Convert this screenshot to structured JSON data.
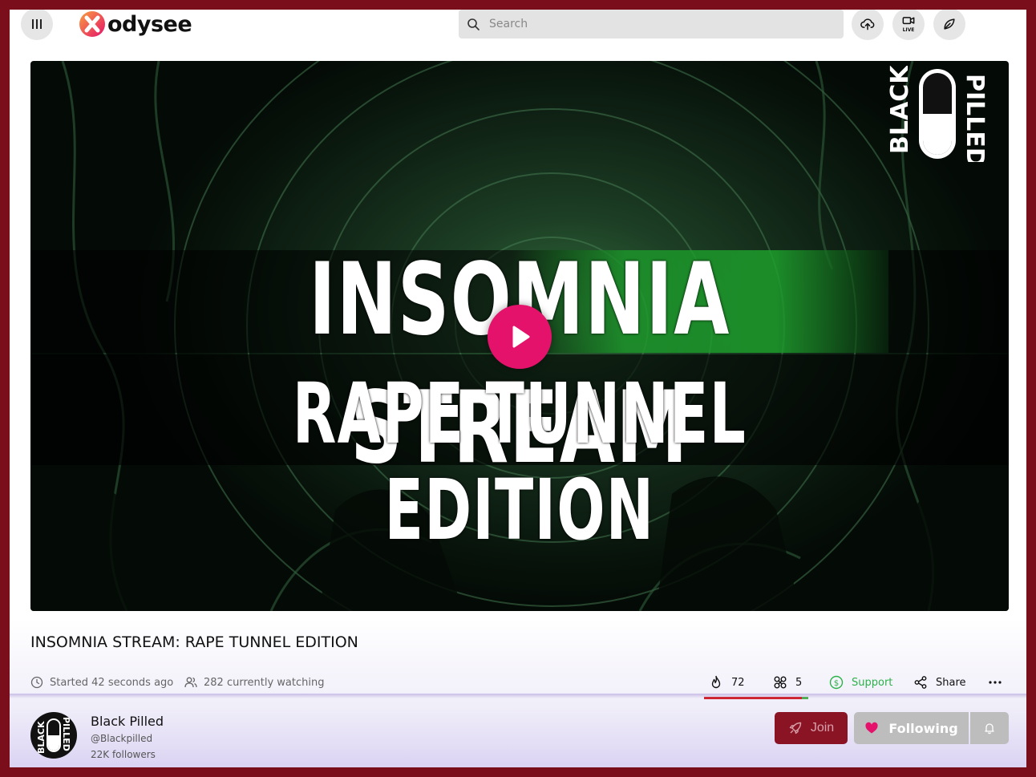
{
  "header": {
    "logo_text": "odysee",
    "search_placeholder": "Search",
    "live_label": "LIVE",
    "icons": [
      "menu-icon",
      "upload-icon",
      "go-live-icon",
      "publish-icon",
      "search-icon"
    ]
  },
  "video": {
    "thumbnail_line1": "INSOMNIA STREAM",
    "thumbnail_line2": "RAPE TUNNEL EDITION",
    "brand_left": "BLACK",
    "brand_right": "PILLED"
  },
  "title": "INSOMNIA STREAM: RAPE TUNNEL EDITION",
  "meta": {
    "started": "Started 42 seconds ago",
    "watching": "282 currently watching"
  },
  "actions": {
    "fire_count": "72",
    "slime_count": "5",
    "support_label": "Support",
    "share_label": "Share",
    "like_ratio": 0.94
  },
  "channel": {
    "name": "Black Pilled",
    "handle": "@Blackpilled",
    "followers": "22K followers",
    "join_label": "Join",
    "following_label": "Following"
  },
  "colors": {
    "accent": "#e5126b",
    "frame": "#7a0e1a",
    "support": "#2db24a",
    "join": "#8a1424"
  }
}
